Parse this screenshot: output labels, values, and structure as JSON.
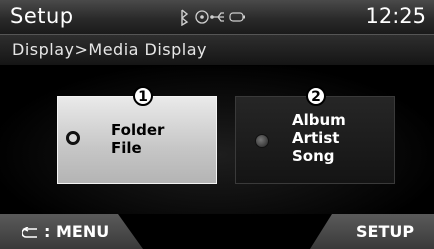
{
  "header": {
    "title": "Setup",
    "clock": "12:25"
  },
  "status_icons": [
    "bluetooth-icon",
    "disc-icon",
    "usb-icon",
    "battery-icon"
  ],
  "breadcrumb": "Display>Media Display",
  "options": [
    {
      "number": "1",
      "lines": [
        "Folder",
        "File"
      ],
      "selected": true
    },
    {
      "number": "2",
      "lines": [
        "Album",
        "Artist",
        "Song"
      ],
      "selected": false
    }
  ],
  "footer": {
    "menu_label": ": MENU",
    "setup_label": "SETUP"
  }
}
